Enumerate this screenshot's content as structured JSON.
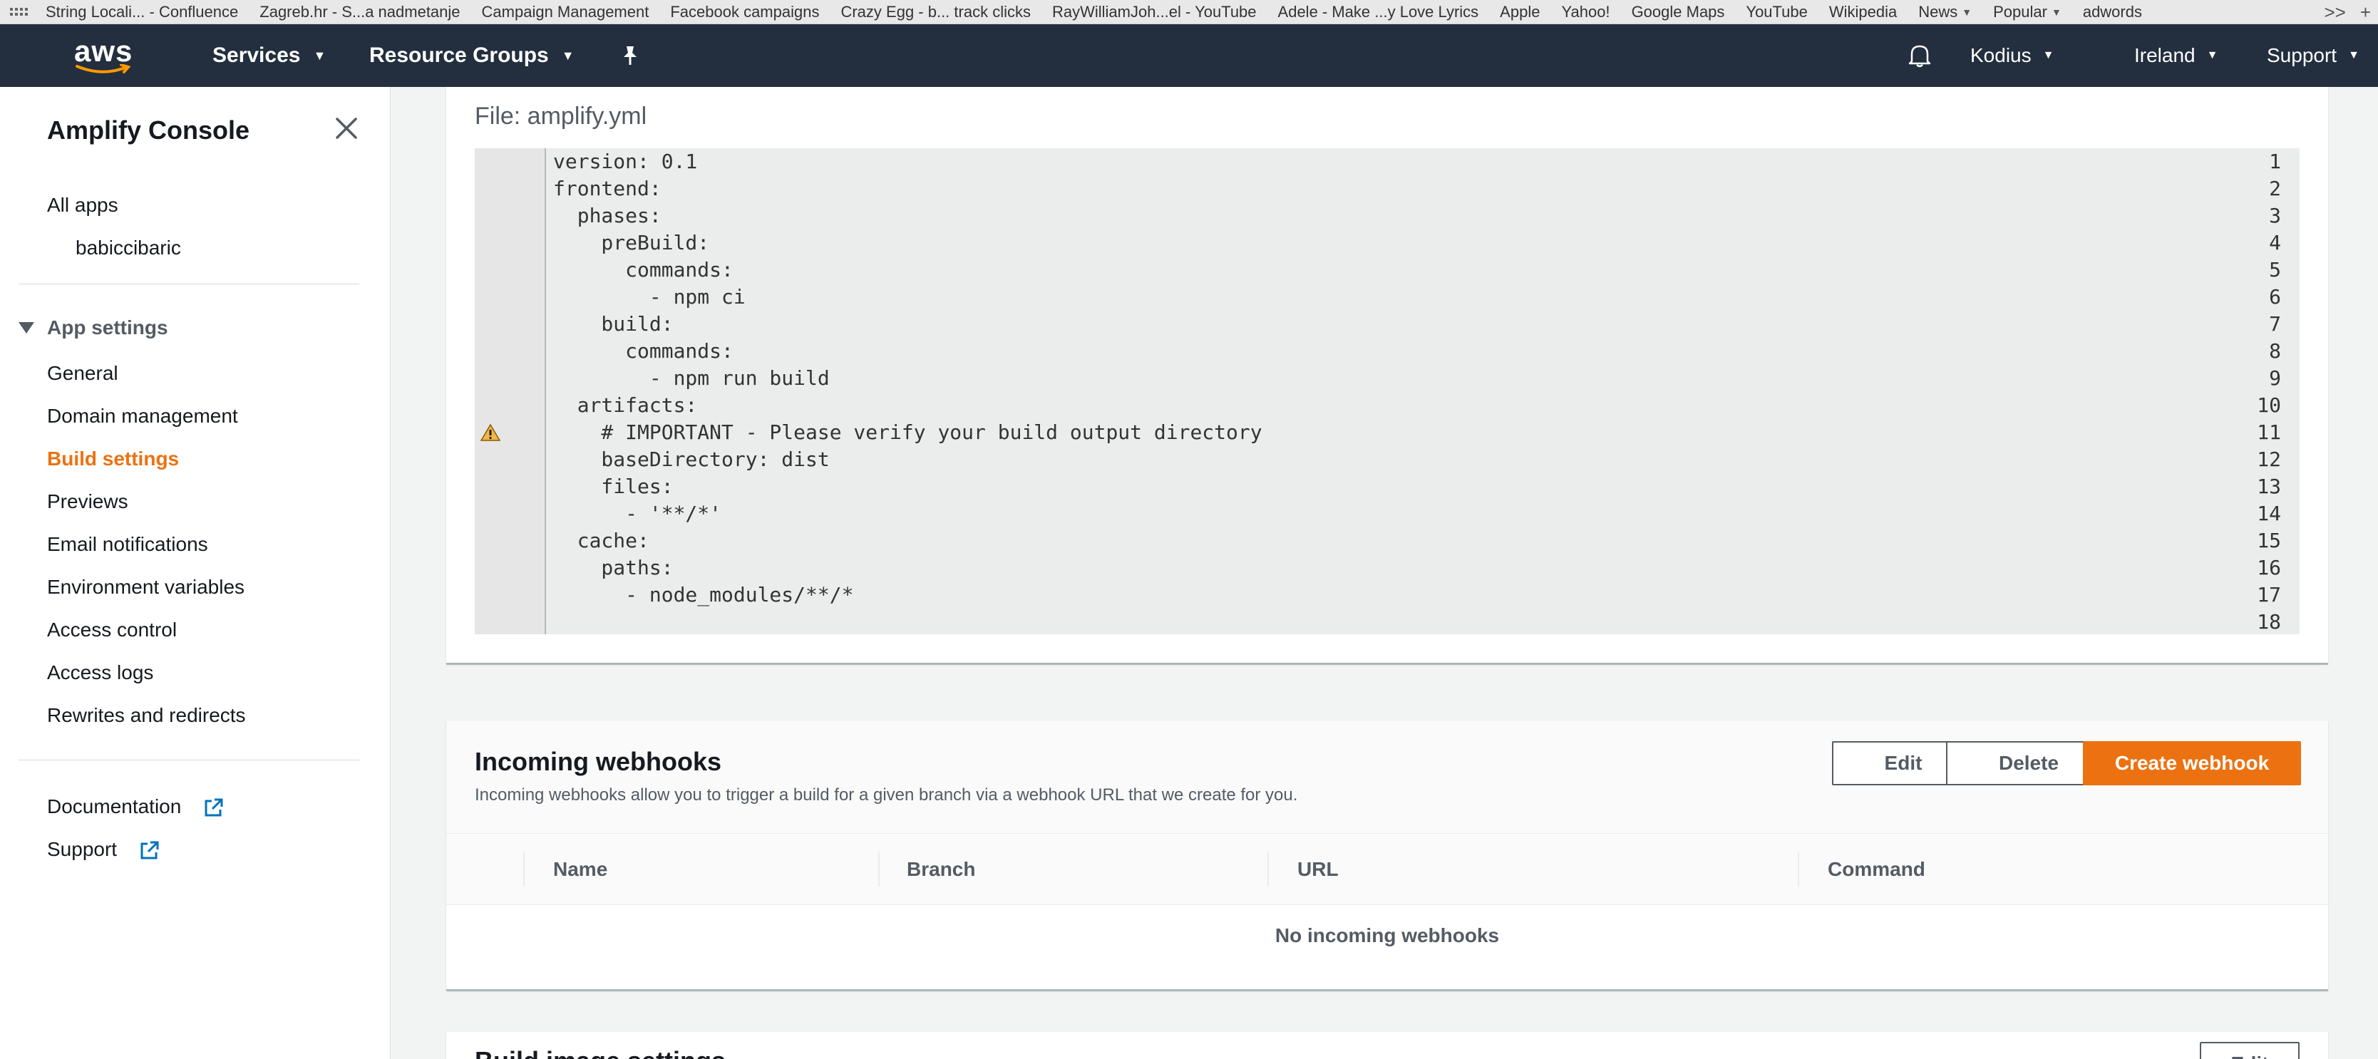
{
  "bookmarks": {
    "items": [
      "String Locali... - Confluence",
      "Zagreb.hr - S...a nadmetanje",
      "Campaign Management",
      "Facebook campaigns",
      "Crazy Egg - b... track clicks",
      "RayWilliamJoh...el - YouTube",
      "Adele - Make ...y Love Lyrics",
      "Apple",
      "Yahoo!",
      "Google Maps",
      "YouTube",
      "Wikipedia"
    ],
    "folders": [
      "News",
      "Popular"
    ],
    "last": "adwords",
    "overflow": ">>",
    "add": "+"
  },
  "nav": {
    "logo": "aws",
    "services": "Services",
    "resource_groups": "Resource Groups",
    "account": "Kodius",
    "region": "Ireland",
    "support": "Support"
  },
  "sidebar": {
    "title": "Amplify Console",
    "all_apps": "All apps",
    "app_name": "babiccibaric",
    "section": "App settings",
    "items": [
      "General",
      "Domain management",
      "Build settings",
      "Previews",
      "Email notifications",
      "Environment variables",
      "Access control",
      "Access logs",
      "Rewrites and redirects"
    ],
    "active_item": "Build settings",
    "documentation": "Documentation",
    "support": "Support"
  },
  "file": {
    "label": "File: amplify.yml",
    "lines": [
      "version: 0.1",
      "frontend:",
      "  phases:",
      "    preBuild:",
      "      commands:",
      "        - npm ci",
      "    build:",
      "      commands:",
      "        - npm run build",
      "  artifacts:",
      "    # IMPORTANT - Please verify your build output directory",
      "    baseDirectory: dist",
      "    files:",
      "      - '**/*'",
      "  cache:",
      "    paths:",
      "      - node_modules/**/*",
      ""
    ],
    "warning_line": 11
  },
  "webhooks": {
    "title": "Incoming webhooks",
    "description": "Incoming webhooks allow you to trigger a build for a given branch via a webhook URL that we create for you.",
    "edit": "Edit",
    "delete": "Delete",
    "create": "Create webhook",
    "columns": [
      "Name",
      "Branch",
      "URL",
      "Command"
    ],
    "empty": "No incoming webhooks"
  },
  "next_section": {
    "title": "Build image settings",
    "edit": "Edit"
  },
  "colors": {
    "nav_bg": "#232f3e",
    "accent": "#ec7211"
  }
}
